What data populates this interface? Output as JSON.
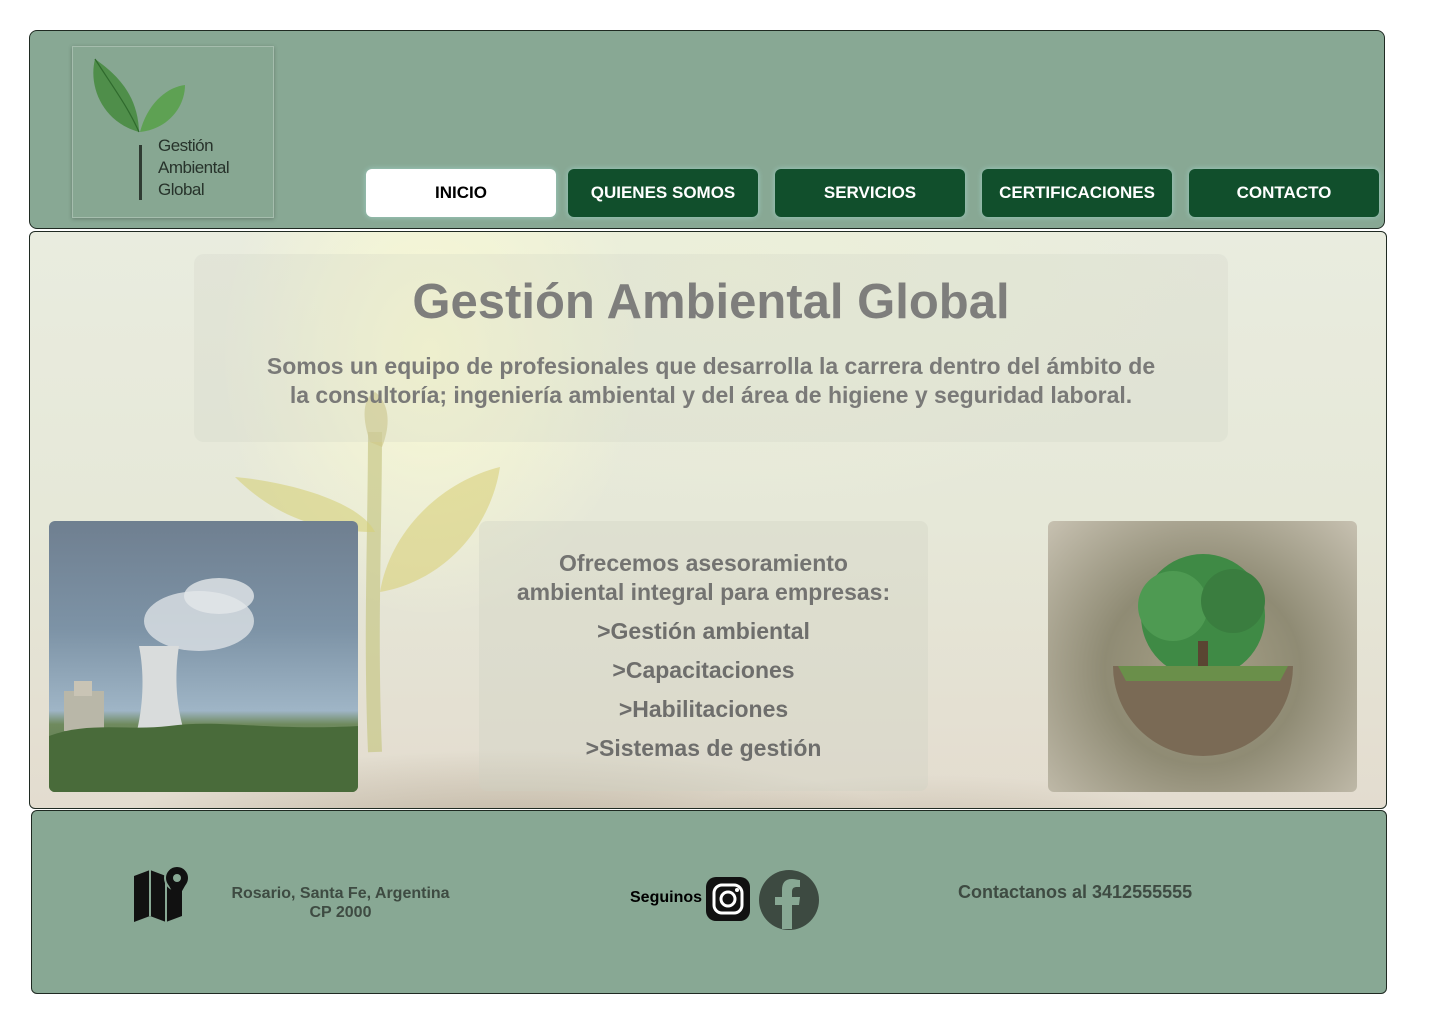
{
  "brand": {
    "logo_lines": [
      "Gestión",
      "Ambiental",
      "Global"
    ],
    "colors": {
      "header_bg": "#88a894",
      "nav_btn": "#114f2c",
      "nav_active": "#ffffff"
    }
  },
  "nav": {
    "items": [
      {
        "label": "INICIO",
        "active": true
      },
      {
        "label": "QUIENES SOMOS",
        "active": false
      },
      {
        "label": "SERVICIOS",
        "active": false
      },
      {
        "label": "CERTIFICACIONES",
        "active": false
      },
      {
        "label": "CONTACTO",
        "active": false
      }
    ]
  },
  "hero": {
    "title": "Gestión Ambiental Global",
    "subtitle_line1": "Somos un equipo de profesionales que desarrolla la carrera dentro del ámbito de",
    "subtitle_line2": "la consultoría; ingeniería ambiental y del área de higiene y seguridad laboral."
  },
  "services": {
    "intro_line1": "Ofrecemos asesoramiento",
    "intro_line2": "ambiental integral para empresas:",
    "items": [
      ">Gestión ambiental",
      ">Capacitaciones",
      ">Habilitaciones",
      ">Sistemas de gestión"
    ]
  },
  "footer": {
    "address_line1": "Rosario, Santa Fe, Argentina",
    "address_line2": "CP 2000",
    "follow_label": "Seguinos",
    "contact": "Contactanos al 3412555555",
    "icons": [
      "map-pin-icon",
      "instagram-icon",
      "facebook-icon"
    ]
  }
}
